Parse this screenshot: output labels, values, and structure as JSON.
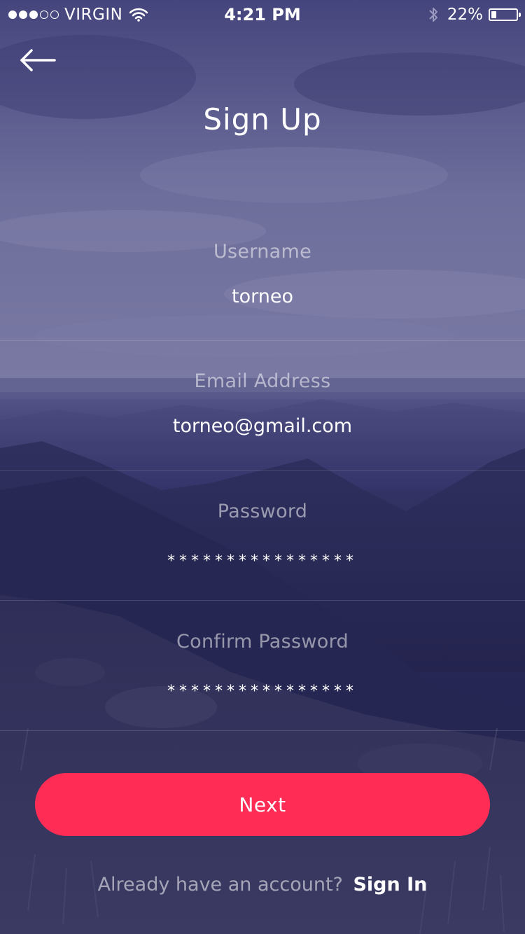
{
  "status_bar": {
    "signal_dots_filled": 3,
    "signal_dots_total": 5,
    "carrier": "VIRGIN",
    "wifi_icon": "wifi-icon",
    "time": "4:21 PM",
    "bluetooth_icon": "bluetooth-icon",
    "battery_text": "22%",
    "battery_level": 0.22
  },
  "header": {
    "back_icon": "arrow-left-icon",
    "title": "Sign Up"
  },
  "form": {
    "fields": [
      {
        "label": "Username",
        "value": "torneo",
        "type": "text"
      },
      {
        "label": "Email Address",
        "value": "torneo@gmail.com",
        "type": "email"
      },
      {
        "label": "Password",
        "value": "****************",
        "type": "password"
      },
      {
        "label": "Confirm Password",
        "value": "****************",
        "type": "password"
      }
    ],
    "next_label": "Next"
  },
  "footer": {
    "prompt": "Already have an account?",
    "link_label": "Sign In"
  },
  "colors": {
    "accent": "#ff2d55",
    "overlay": "#2c2c5c"
  }
}
